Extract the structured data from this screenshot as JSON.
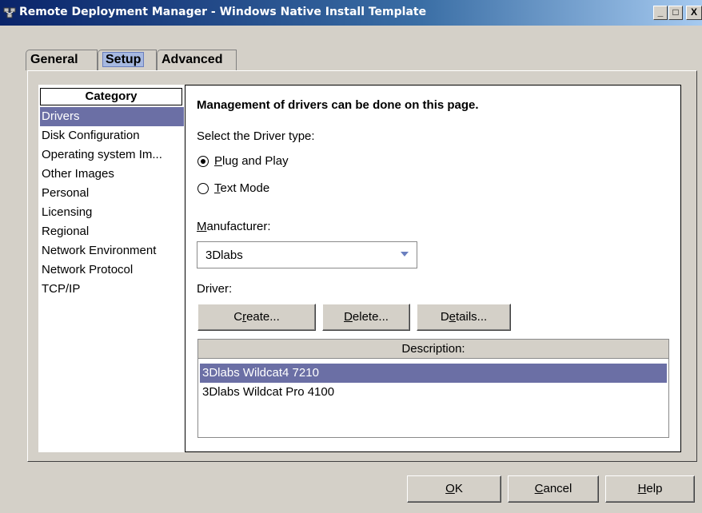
{
  "window": {
    "title": "Remote Deployment Manager - Windows Native Install Template",
    "minimize": "_",
    "maximize": "□",
    "close": "X"
  },
  "tabs": [
    {
      "label": "General",
      "selected": false
    },
    {
      "label": "Setup",
      "selected": true
    },
    {
      "label": "Advanced",
      "selected": false
    }
  ],
  "category": {
    "header": "Category",
    "items": [
      {
        "label": "Drivers",
        "selected": true
      },
      {
        "label": "Disk Configuration"
      },
      {
        "label": "Operating system Im..."
      },
      {
        "label": "Other Images"
      },
      {
        "label": "Personal"
      },
      {
        "label": "Licensing"
      },
      {
        "label": "Regional"
      },
      {
        "label": "Network Environment"
      },
      {
        "label": "Network Protocol"
      },
      {
        "label": "TCP/IP"
      }
    ]
  },
  "drivers": {
    "heading": "Management of drivers can be done on this page.",
    "select_type_label": "Select the Driver type:",
    "radio_plug_and_play": {
      "mnemonic": "P",
      "rest": "lug and Play",
      "checked": true
    },
    "radio_text_mode": {
      "mnemonic": "T",
      "rest": "ext Mode",
      "checked": false
    },
    "manufacturer_label_mnemonic": "M",
    "manufacturer_label_rest": "anufacturer:",
    "manufacturer_value": "3Dlabs",
    "driver_label": "Driver:",
    "buttons": {
      "create_pre": "C",
      "create_mnemonic": "r",
      "create_post": "eate...",
      "delete_mnemonic": "D",
      "delete_post": "elete...",
      "details_pre": "D",
      "details_mnemonic": "e",
      "details_post": "tails..."
    },
    "table": {
      "column": "Description:",
      "rows": [
        {
          "description": "3Dlabs Wildcat4 7210",
          "selected": true
        },
        {
          "description": "3Dlabs Wildcat Pro 4100",
          "selected": false
        }
      ]
    }
  },
  "footer": {
    "ok_mnemonic": "O",
    "ok_rest": "K",
    "cancel_mnemonic": "C",
    "cancel_rest": "ancel",
    "help_mnemonic": "H",
    "help_rest": "elp"
  },
  "colors": {
    "selection": "#6b6fa5",
    "titlebar": "#0a246a",
    "dialog_bg": "#d4d0c8"
  }
}
